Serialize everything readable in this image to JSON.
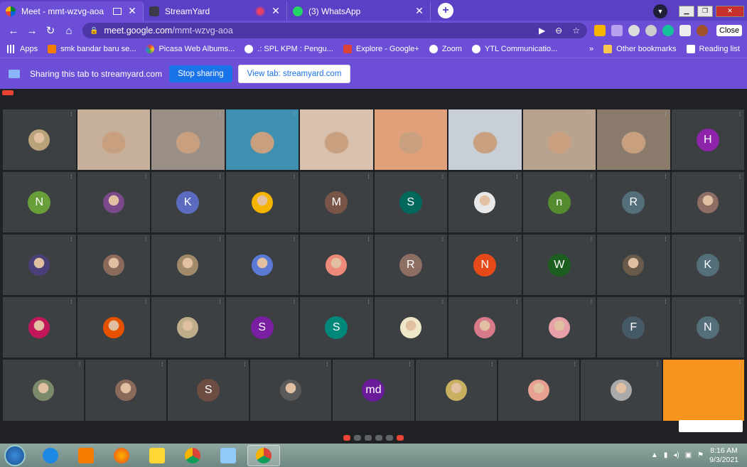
{
  "tabs": [
    {
      "label": "Meet - mmt-wzvg-aoa",
      "active": true
    },
    {
      "label": "StreamYard",
      "active": false
    },
    {
      "label": "(3) WhatsApp",
      "active": false
    }
  ],
  "window": {
    "close_label": "Close"
  },
  "omnibox": {
    "host": "meet.google.com",
    "path": "/mmt-wzvg-aoa"
  },
  "bookmarks": {
    "items": [
      "Apps",
      "smk bandar baru se...",
      "Picasa Web Albums...",
      ".: SPL KPM : Pengu...",
      "Explore - Google+",
      "Zoom",
      "YTL Communicatio..."
    ],
    "overflow": "»",
    "other": "Other bookmarks",
    "reading": "Reading list"
  },
  "sharing": {
    "message": "Sharing this tab to streamyard.com",
    "stop": "Stop sharing",
    "view": "View tab: streamyard.com"
  },
  "meet": {
    "rows": [
      [
        {
          "kind": "photo",
          "color": "#b9a27a"
        },
        {
          "kind": "video",
          "color": "#c7b09a",
          "hl": true
        },
        {
          "kind": "video",
          "color": "#9a8f86"
        },
        {
          "kind": "video",
          "color": "#3f8fb0"
        },
        {
          "kind": "video",
          "color": "#d9c1ae"
        },
        {
          "kind": "video",
          "color": "#e0a07a"
        },
        {
          "kind": "video",
          "color": "#c9cfd6"
        },
        {
          "kind": "video",
          "color": "#b8a48e"
        },
        {
          "kind": "video",
          "color": "#8a7a6c"
        },
        {
          "kind": "letter",
          "letter": "H",
          "color": "#8e24aa"
        }
      ],
      [
        {
          "kind": "letter",
          "letter": "N",
          "color": "#689f38"
        },
        {
          "kind": "photo",
          "color": "#7b4a8a"
        },
        {
          "kind": "letter",
          "letter": "K",
          "color": "#5c6bc0"
        },
        {
          "kind": "photo",
          "color": "#f4b400"
        },
        {
          "kind": "letter",
          "letter": "M",
          "color": "#795548"
        },
        {
          "kind": "letter",
          "letter": "S",
          "color": "#00695c"
        },
        {
          "kind": "photo",
          "color": "#e8e8e8"
        },
        {
          "kind": "letter",
          "letter": "n",
          "color": "#558b2f"
        },
        {
          "kind": "letter",
          "letter": "R",
          "color": "#546e7a"
        },
        {
          "kind": "photo",
          "color": "#8d6e63"
        }
      ],
      [
        {
          "kind": "photo",
          "color": "#4a3f78"
        },
        {
          "kind": "photo",
          "color": "#8a6a5a"
        },
        {
          "kind": "photo",
          "color": "#a08a6a"
        },
        {
          "kind": "photo",
          "color": "#5a7ad6"
        },
        {
          "kind": "photo",
          "color": "#ee8a7a"
        },
        {
          "kind": "letter",
          "letter": "R",
          "color": "#8d6e63"
        },
        {
          "kind": "letter",
          "letter": "N",
          "color": "#e64a19"
        },
        {
          "kind": "letter",
          "letter": "W",
          "color": "#1b5e20"
        },
        {
          "kind": "photo",
          "color": "#6a5a4a"
        },
        {
          "kind": "letter",
          "letter": "K",
          "color": "#546e7a"
        }
      ],
      [
        {
          "kind": "photo",
          "color": "#c2185b"
        },
        {
          "kind": "photo",
          "color": "#e65100"
        },
        {
          "kind": "photo",
          "color": "#bfae8a"
        },
        {
          "kind": "letter",
          "letter": "S",
          "color": "#7b1fa2"
        },
        {
          "kind": "letter",
          "letter": "S",
          "color": "#00897b"
        },
        {
          "kind": "photo",
          "color": "#f0e6c8"
        },
        {
          "kind": "photo",
          "color": "#d87a8a"
        },
        {
          "kind": "photo",
          "color": "#e8a0a8"
        },
        {
          "kind": "letter",
          "letter": "F",
          "color": "#455a64"
        },
        {
          "kind": "letter",
          "letter": "N",
          "color": "#546e7a"
        }
      ]
    ],
    "row5": [
      {
        "kind": "photo",
        "color": "#7a8a6a"
      },
      {
        "kind": "photo",
        "color": "#8a6a5a"
      },
      {
        "kind": "letter",
        "letter": "S",
        "color": "#6d4c41"
      },
      {
        "kind": "photo",
        "color": "#5a5a5a"
      },
      {
        "kind": "letter",
        "letter": "md",
        "color": "#6a1b9a"
      },
      {
        "kind": "photo",
        "color": "#c8b060"
      },
      {
        "kind": "photo",
        "color": "#e8a090"
      },
      {
        "kind": "photo",
        "color": "#aaaaaa"
      },
      {
        "kind": "orange",
        "color": "#f7941d"
      }
    ]
  },
  "taskbar": {
    "time": "8:16 AM",
    "date": "9/3/2021"
  }
}
